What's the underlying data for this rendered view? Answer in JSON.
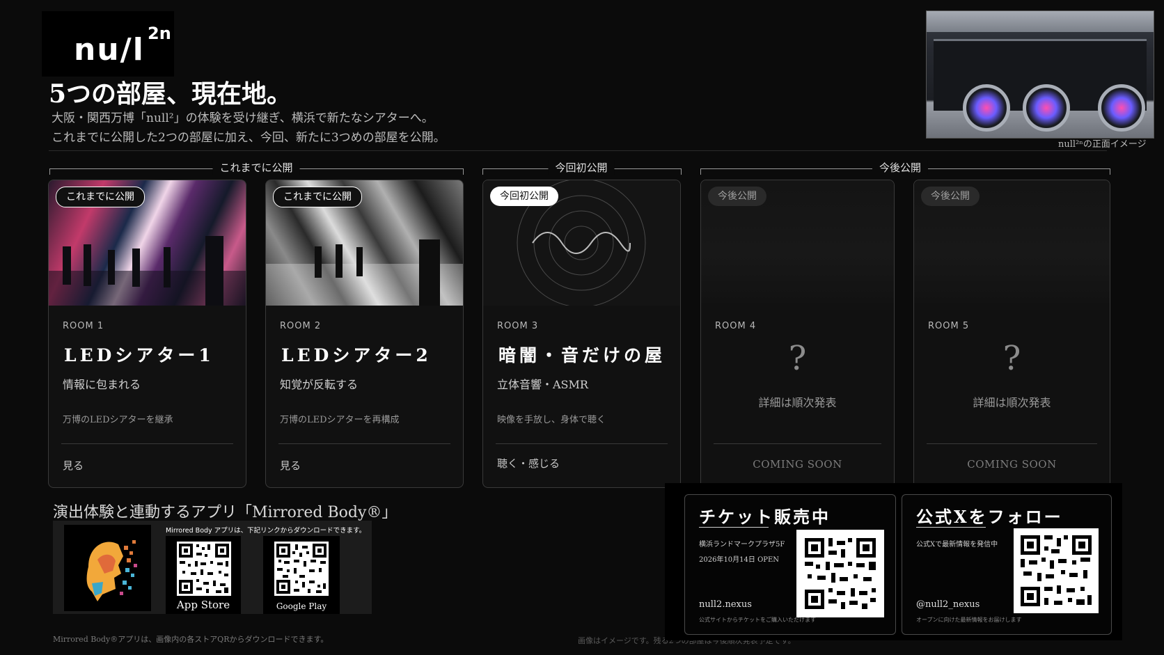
{
  "brand": {
    "logo_text": "nu/l",
    "logo_sup": "2n"
  },
  "header": {
    "headline": "5つの部屋、現在地。",
    "subline_1": "大阪・関西万博「null²」の体験を受け継ぎ、横浜で新たなシアターへ。",
    "subline_2": "これまでに公開した2つの部屋に加え、今回、新たに3つめの部屋を公開。"
  },
  "photo": {
    "caption": "null²ⁿの正面イメージ"
  },
  "groups": [
    {
      "label": "これまでに公開"
    },
    {
      "label": "今回初公開"
    },
    {
      "label": "今後公開"
    }
  ],
  "rooms": [
    {
      "badge": "これまでに公開",
      "number": "ROOM 1",
      "title": "LEDシアター1",
      "subtitle": "情報に包まれる",
      "description": "万博のLEDシアターを継承",
      "action": "見る"
    },
    {
      "badge": "これまでに公開",
      "number": "ROOM 2",
      "title": "LEDシアター2",
      "subtitle": "知覚が反転する",
      "description": "万博のLEDシアターを再構成",
      "action": "見る"
    },
    {
      "badge": "今回初公開",
      "number": "ROOM 3",
      "title": "暗闇・音だけの屋",
      "subtitle": "立体音響・ASMR",
      "description": "映像を手放し、身体で聴く",
      "action": "聴く・感じる"
    },
    {
      "badge": "今後公開",
      "number": "ROOM 4",
      "placeholder": "?",
      "tba": "詳細は順次発表",
      "status": "COMING SOON"
    },
    {
      "badge": "今後公開",
      "number": "ROOM 5",
      "placeholder": "?",
      "tba": "詳細は順次発表",
      "status": "COMING SOON"
    }
  ],
  "app": {
    "title": "演出体験と連動するアプリ「Mirrored Body®」",
    "panel_text": "Mirrored Body アプリは、下記リンクからダウンロードできます。",
    "app_store_label": "App Store",
    "google_play_label": "Google Play",
    "footnote": "Mirrored Body®アプリは、画像内の各ストアQRからダウンロードできます。"
  },
  "footnote_mid": "画像はイメージです。残る2つの部屋は今後順次発表予定です。",
  "ticket": {
    "title": "チケット販売中",
    "venue": "横浜ランドマークプラザ5F",
    "open_date": "2026年10月14日 OPEN",
    "url": "null2.nexus",
    "fine": "公式サイトからチケットをご購入いただけます"
  },
  "follow": {
    "title": "公式Xをフォロー",
    "line": "公式Xで最新情報を発信中",
    "handle": "@null2_nexus",
    "fine": "オープンに向けた最新情報をお届けします"
  },
  "colors": {
    "background": "#0b0b0b",
    "card": "#111111",
    "accent_white": "#ffffff"
  }
}
